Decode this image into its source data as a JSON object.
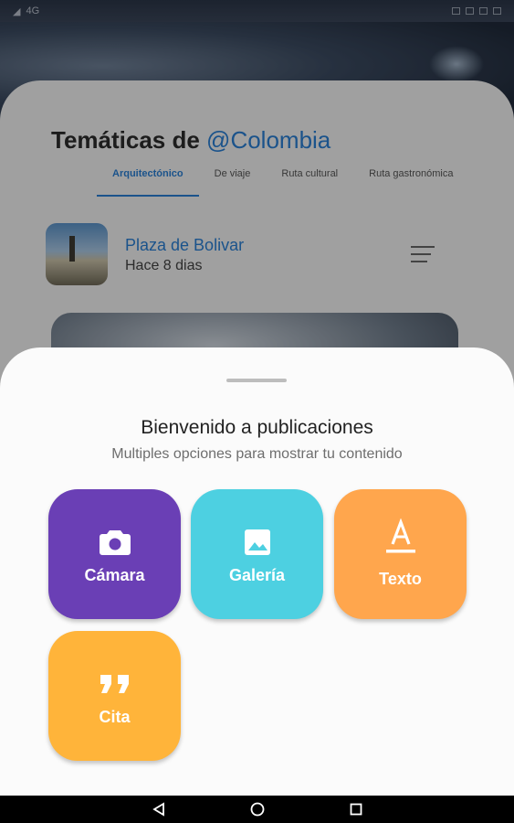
{
  "status_bar": {
    "left": "4G"
  },
  "page": {
    "title_prefix": "Temáticas de ",
    "title_handle": "@Colombia",
    "tabs": [
      {
        "label": "Arquitectónico",
        "active": true
      },
      {
        "label": "De viaje",
        "active": false
      },
      {
        "label": "Ruta cultural",
        "active": false
      },
      {
        "label": "Ruta gastronómica",
        "active": false
      }
    ],
    "post": {
      "title": "Plaza de Bolivar",
      "subtitle": "Hace 8 dias"
    }
  },
  "sheet": {
    "title": "Bienvenido a publicaciones",
    "subtitle": "Multiples opciones para mostrar tu contenido",
    "options": [
      {
        "label": "Cámara",
        "icon": "camera-icon",
        "color": "#6a3fb5"
      },
      {
        "label": "Galería",
        "icon": "image-icon",
        "color": "#4dd0e1"
      },
      {
        "label": "Texto",
        "icon": "text-format-icon",
        "color": "#ffa64d"
      },
      {
        "label": "Cita",
        "icon": "quote-icon",
        "color": "#ffb43a"
      }
    ]
  },
  "colors": {
    "accent": "#2a7fd4",
    "sheet_bg": "#fbfbfb"
  }
}
